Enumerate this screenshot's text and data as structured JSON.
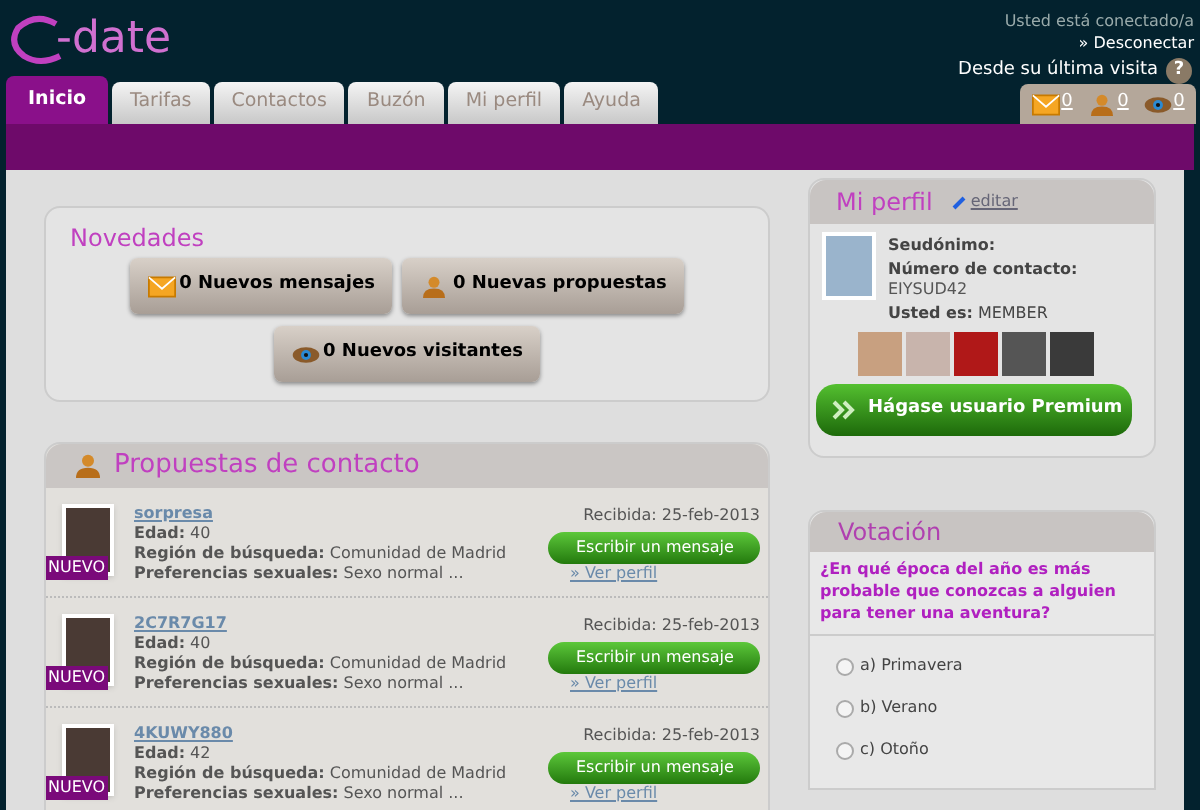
{
  "header": {
    "logo": "-date",
    "status": "Usted está conectado/a",
    "logout": "» Desconectar",
    "last_visit": "Desde su última visita",
    "help": "?",
    "counters": [
      {
        "kind": "mail",
        "value": "0"
      },
      {
        "kind": "person",
        "value": "0"
      },
      {
        "kind": "eye",
        "value": "0"
      }
    ]
  },
  "tabs": [
    {
      "label": "Inicio",
      "selected": true
    },
    {
      "label": "Tarifas",
      "selected": false
    },
    {
      "label": "Contactos",
      "selected": false
    },
    {
      "label": "Buzón",
      "selected": false
    },
    {
      "label": "Mi perfil",
      "selected": false
    },
    {
      "label": "Ayuda",
      "selected": false
    }
  ],
  "novedades": {
    "title": "Novedades",
    "buttons": [
      {
        "kind": "mail",
        "label": "0 Nuevos mensajes"
      },
      {
        "kind": "person",
        "label": "0 Nuevas propuestas"
      },
      {
        "kind": "eye",
        "label": "0 Nuevos visitantes"
      }
    ]
  },
  "proposals": {
    "title": "Propuestas de contacto",
    "rows": [
      {
        "name": "sorpresa",
        "age": "**Edad:** 40",
        "region": "**Región de búsqueda:** Comunidad de Madrid",
        "prefs": "**Preferencias sexuales:** Sexo normal ...",
        "badge": "NUEVO",
        "received": "Recibida: 25-feb-2013",
        "action": "Escribir un mensaje",
        "profile": "» Ver perfil"
      },
      {
        "name": "2C7R7G17",
        "age": "**Edad:** 40",
        "region": "**Región de búsqueda:** Comunidad de Madrid",
        "prefs": "**Preferencias sexuales:** Sexo normal ...",
        "badge": "NUEVO",
        "received": "Recibida: 25-feb-2013",
        "action": "Escribir un mensaje",
        "profile": "» Ver perfil"
      },
      {
        "name": "4KUWY880",
        "age": "**Edad:** 42",
        "region": "**Región de búsqueda:** Comunidad de Madrid",
        "prefs": "**Preferencias sexuales:** Sexo normal ...",
        "badge": "NUEVO",
        "received": "Recibida: 25-feb-2013",
        "action": "Escribir un mensaje",
        "profile": "» Ver perfil"
      }
    ]
  },
  "profile": {
    "title": "Mi perfil",
    "edit": "editar",
    "pseudonym": "Seudónimo:",
    "contact_label": "Número de contacto:",
    "contact": "EIYSUD42",
    "role": "**Usted es:** MEMBER",
    "premium": "Hágase usuario Premium"
  },
  "poll": {
    "title": "Votación",
    "question": "¿En qué época del año es más probable que conozcas a alguien para tener una aventura?",
    "options": [
      {
        "label": "a) Primavera",
        "selected": false
      },
      {
        "label": "b) Verano",
        "selected": false
      },
      {
        "label": "c) Otoño",
        "selected": false
      }
    ]
  }
}
